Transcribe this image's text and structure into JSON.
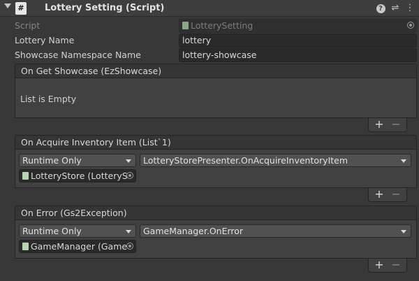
{
  "header": {
    "title": "Lottery Setting (Script)",
    "script_icon_glyph": "#",
    "help_glyph": "?",
    "preset_glyph": "⇌",
    "menu_glyph": "⋮"
  },
  "fields": {
    "script": {
      "label": "Script",
      "value": "LotterySetting"
    },
    "lottery_name": {
      "label": "Lottery Name",
      "value": "lottery"
    },
    "showcase_namespace": {
      "label": "Showcase Namespace Name",
      "value": "lottery-showcase"
    }
  },
  "events": [
    {
      "title": "On Get Showcase (EzShowcase)",
      "empty_text": "List is Empty"
    },
    {
      "title": "On Acquire Inventory Item (List`1)",
      "runtime": "Runtime Only",
      "function": "LotteryStorePresenter.OnAcquireInventoryItem",
      "target": "LotteryStore (LotteryS"
    },
    {
      "title": "On Error (Gs2Exception)",
      "runtime": "Runtime Only",
      "function": "GameManager.OnError",
      "target": "GameManager (Game"
    }
  ],
  "list_controls": {
    "plus": "+",
    "minus": "−"
  },
  "colors": {
    "background": "#383838",
    "header": "#3e3e3e",
    "field": "#2a2a2a",
    "dropdown": "#515151"
  }
}
